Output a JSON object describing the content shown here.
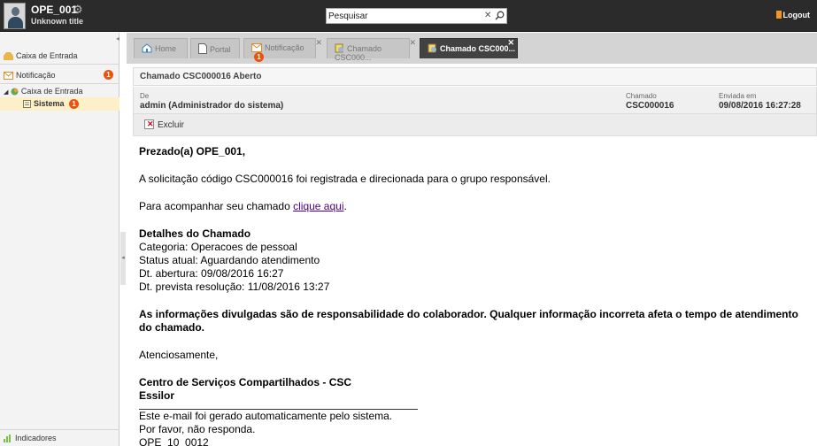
{
  "header": {
    "user_name": "OPE_001",
    "user_subtitle": "Unknown title",
    "search_placeholder": "Pesquisar",
    "logout_label": "Logout"
  },
  "sidebar": {
    "inbox_label": "Caixa de Entrada",
    "notification_label": "Notificação",
    "notification_count": "1",
    "tree_inbox_label": "Caixa de Entrada",
    "tree_system_label": "Sistema",
    "tree_system_count": "1",
    "indicators_label": "Indicadores"
  },
  "tabs": [
    {
      "label": "Home",
      "icon": "home-icon"
    },
    {
      "label": "Portal",
      "icon": "document-icon"
    },
    {
      "label": "Notificação",
      "icon": "envelope-icon",
      "badge": "1"
    },
    {
      "label": "Chamado CSC000...",
      "icon": "ticket-icon"
    },
    {
      "label": "Chamado CSC000...",
      "icon": "ticket-icon",
      "active": true
    }
  ],
  "message": {
    "subject": "Chamado CSC000016 Aberto",
    "from_label": "De",
    "from_value": "admin (Administrador do sistema)",
    "ticket_label": "Chamado",
    "ticket_value": "CSC000016",
    "sent_label": "Enviada em",
    "sent_value": "09/08/2016 16:27:28",
    "delete_label": "Excluir",
    "greeting": "Prezado(a) OPE_001,",
    "line1": "A solicitação código CSC000016 foi registrada e direcionada para o grupo responsável.",
    "follow_prefix": "Para acompanhar seu chamado ",
    "follow_link": "clique aqui",
    "follow_suffix": ".",
    "details_title": "Detalhes do Chamado",
    "detail_category": "Categoria: Operacoes de pessoal",
    "detail_status": "Status atual: Aguardando atendimento",
    "detail_opened": "Dt. abertura: 09/08/2016 16:27",
    "detail_due": "Dt. prevista resolução: 11/08/2016 13:27",
    "disclaimer": "As informações divulgadas são de responsabilidade do colaborador. Qualquer informação incorreta afeta o tempo de atendimento do chamado.",
    "closing": "Atenciosamente,",
    "org_name": "Centro de Serviços Compartilhados - CSC",
    "company": "Essilor",
    "auto_note": "Este e-mail foi gerado automaticamente pelo sistema.",
    "no_reply": "Por favor, não responda.",
    "code": "OPE_10_0012"
  },
  "colors": {
    "topbar": "#2b2b2b",
    "active_tab": "#424242",
    "badge": "#e8530e",
    "selected_row": "#fdf0c8",
    "link": "#4b0082"
  }
}
